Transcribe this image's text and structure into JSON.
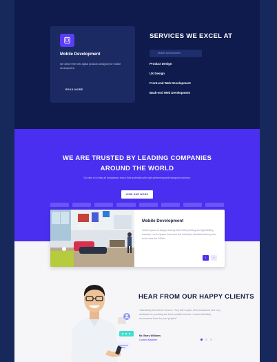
{
  "services_card": {
    "icon": "monitor-icon",
    "title": "Mobile Development",
    "text": "We deliver the best digital products designed for mobile development.",
    "link_label": "READ MORE"
  },
  "services": {
    "heading": "SERVICES WE EXCEL AT",
    "active_item": "Mobile Development",
    "items": [
      "Product Design",
      "UX Design",
      "Front-end Web Development",
      "Back-end Web Development"
    ]
  },
  "trusted": {
    "title_line1": "WE ARE TRUSTED BY LEADING COMPANIES",
    "title_line2": "AROUND THE WORLD",
    "subtitle": "Our aim is to help all businesses reach their potential with high performing technological solutions.",
    "button_label": "VIEW OUR WORK"
  },
  "project": {
    "title": "Mobile Development",
    "text": "Lorem Ipsum is simply dummy text of the printing and typesetting industry. Lorem Ipsum has been the industry's standard dummy text ever since the 1500s.",
    "next_icon": "chevron-right-icon",
    "prev_icon": "chevron-left-icon",
    "next_glyph": "›",
    "prev_glyph": "‹"
  },
  "testimonials": {
    "heading": "HEAR FROM OUR HAPPY CLIENTS",
    "quote": "\"Absolutely loved their service. They were quick, their turnaround and very dedicated to providing the best possible service. I would definitely recommend them for your project.\"",
    "author": "Mr. Barry Williams",
    "role": "Content Marketer",
    "dots": 3,
    "active_dot": 1
  },
  "colors": {
    "navy": "#0f1b4d",
    "navy_card": "#1b2a63",
    "purple": "#4b2ff0",
    "page_bg": "#f6f6f8",
    "outer_bg": "#152a5c"
  }
}
